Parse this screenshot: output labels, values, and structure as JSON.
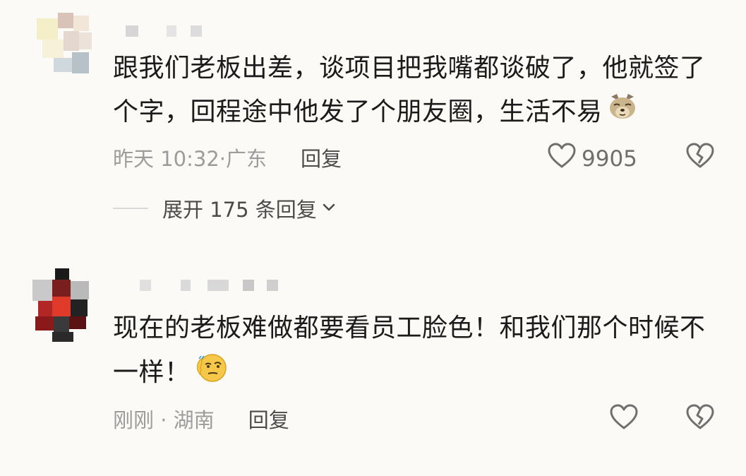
{
  "comments": [
    {
      "text": "跟我们老板出差，谈项目把我嘴都谈破了，他就签了个字，回程途中他发了个朋友圈，生活不易",
      "emoji": "dog-face-emoji",
      "time": "昨天 10:32",
      "separator": "·",
      "location": "广东",
      "reply_label": "回复",
      "like_count": "9905",
      "expand_label": "展开 175 条回复"
    },
    {
      "text": "现在的老板难做都要看员工脸色！和我们那个时候不一样！",
      "emoji": "smug-face-emoji",
      "time": "刚刚",
      "separator": " · ",
      "location": "湖南",
      "reply_label": "回复"
    }
  ],
  "icons": {
    "like": "heart-icon",
    "dislike": "broken-heart-icon",
    "expand": "chevron-down-icon"
  },
  "colors": {
    "background": "#fbfaf6",
    "text": "#1b1b1b",
    "meta": "#9c9c9c",
    "reply": "#4b4b4b"
  }
}
